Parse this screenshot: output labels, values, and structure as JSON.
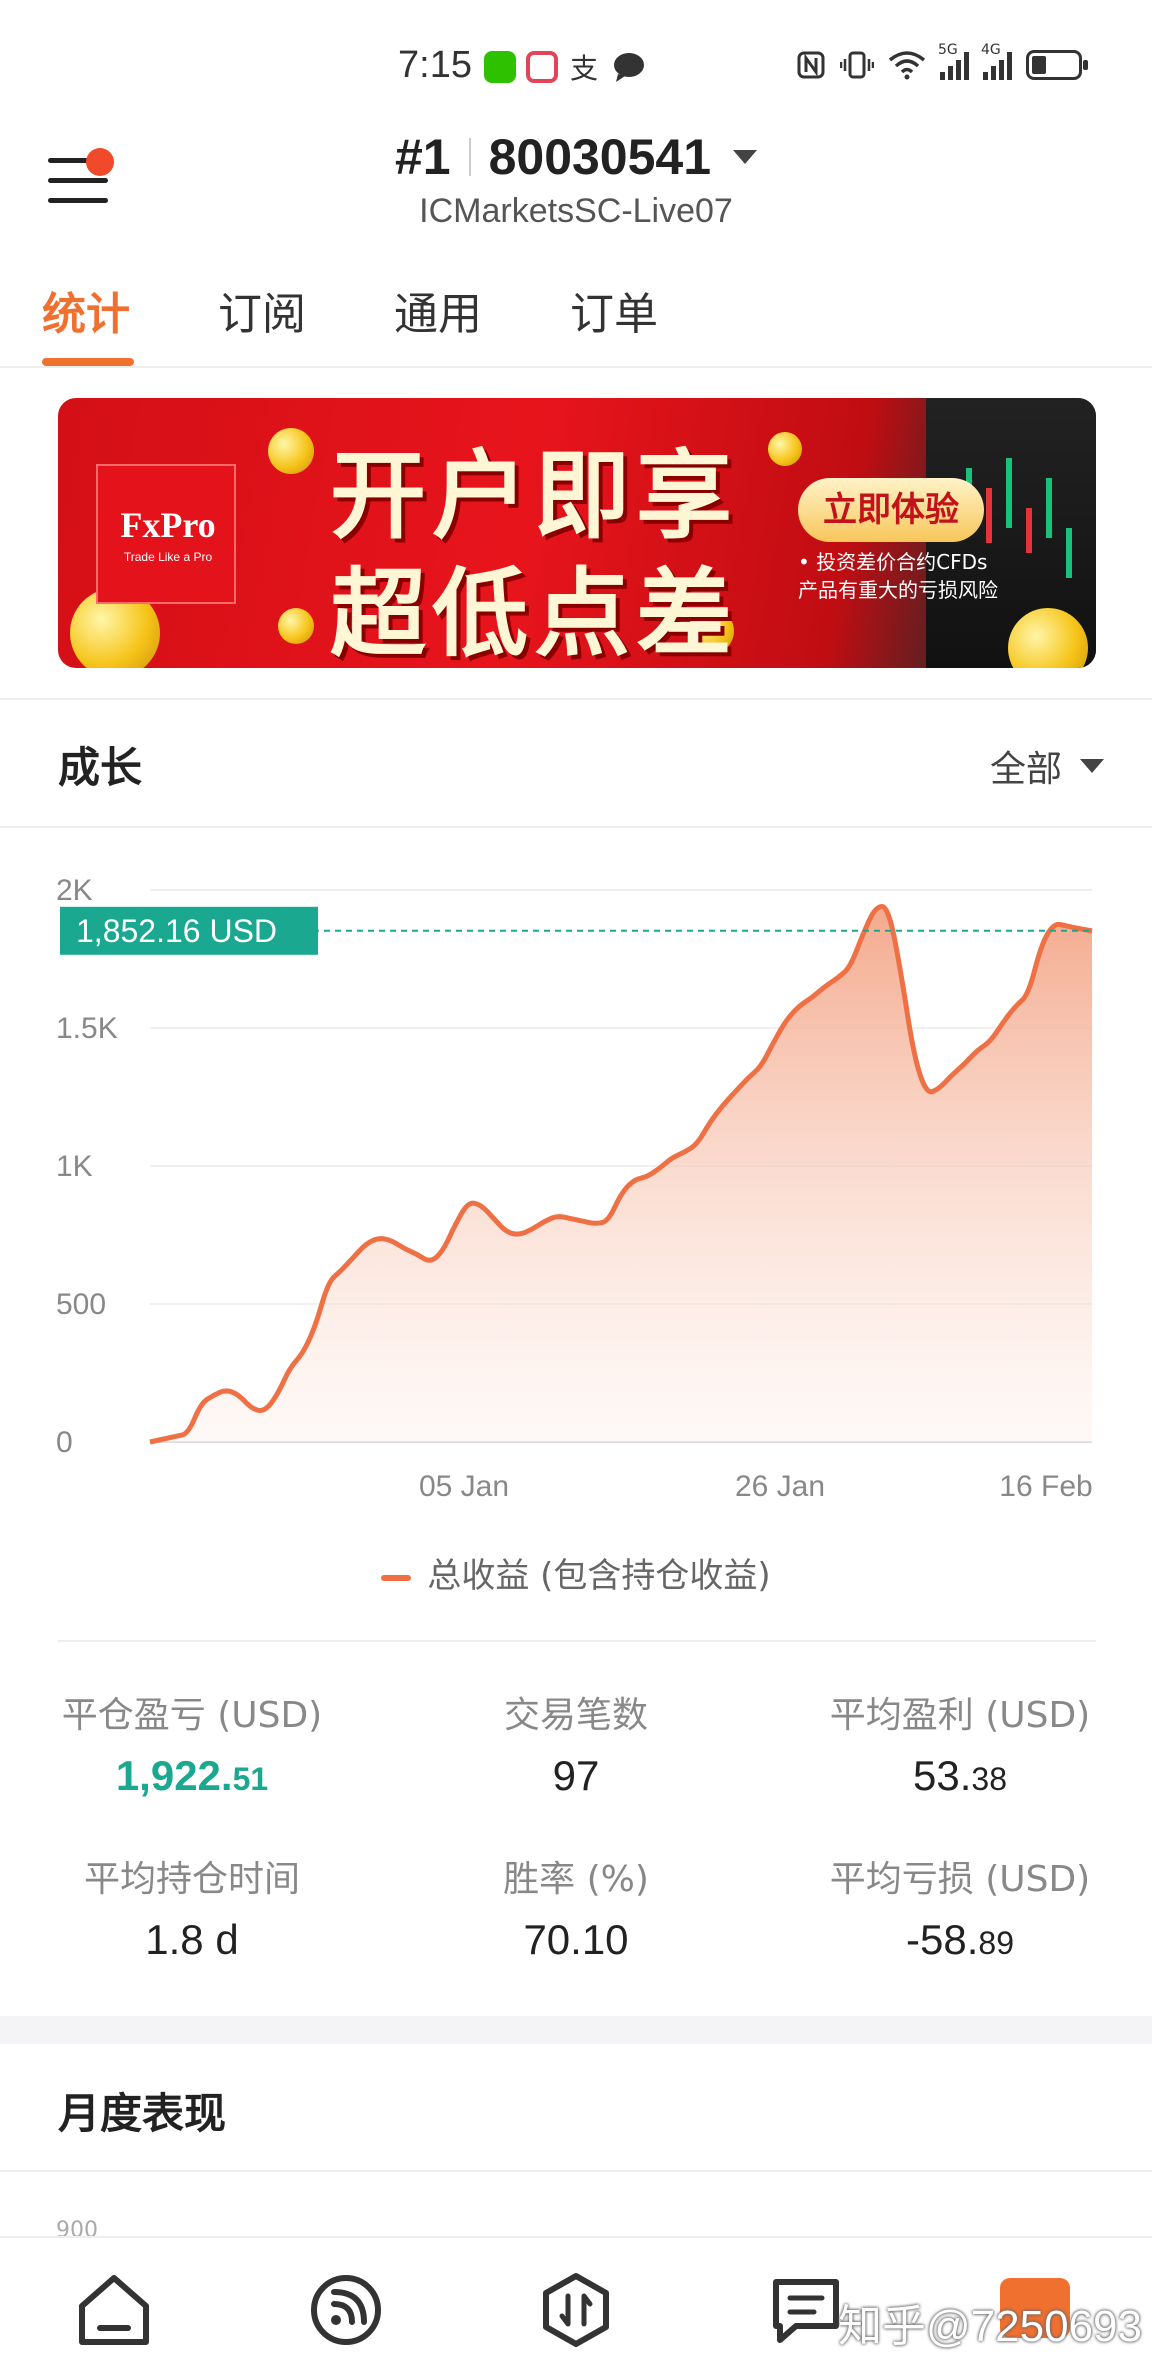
{
  "status_bar": {
    "time": "7:15",
    "signal_1": "5G",
    "signal_2": "4G"
  },
  "header": {
    "rank": "#1",
    "account": "80030541",
    "server": "ICMarketsSC-Live07"
  },
  "tabs": [
    {
      "label": "统计",
      "active": true
    },
    {
      "label": "订阅",
      "active": false
    },
    {
      "label": "通用",
      "active": false
    },
    {
      "label": "订单",
      "active": false
    }
  ],
  "banner": {
    "logo": "FxPro",
    "tagline": "Trade Like a Pro",
    "line1": "开户即享",
    "line2": "超低点差",
    "cta": "立即体验",
    "risk_1": "• 投资差价合约CFDs",
    "risk_2": "产品有重大的亏损风险"
  },
  "growth": {
    "title": "成长",
    "filter": "全部",
    "current_label": "1,852.16 USD",
    "legend": "总收益 (包含持仓收益)"
  },
  "chart_data": {
    "type": "area",
    "y_ticks": [
      "2K",
      "1.5K",
      "1K",
      "500",
      "0"
    ],
    "x_ticks": [
      "05 Jan",
      "26 Jan",
      "16 Feb"
    ],
    "ylim": [
      0,
      2000
    ],
    "current_value": 1852.16,
    "series": [
      {
        "name": "总收益 (包含持仓收益)",
        "values": [
          0,
          10,
          20,
          30,
          140,
          170,
          190,
          170,
          120,
          110,
          170,
          270,
          320,
          420,
          580,
          620,
          670,
          720,
          740,
          730,
          700,
          680,
          650,
          690,
          790,
          870,
          860,
          810,
          760,
          750,
          770,
          800,
          820,
          810,
          800,
          790,
          800,
          900,
          950,
          960,
          990,
          1030,
          1050,
          1080,
          1160,
          1220,
          1270,
          1320,
          1360,
          1450,
          1530,
          1580,
          1610,
          1650,
          1680,
          1720,
          1840,
          1940,
          1940,
          1700,
          1400,
          1260,
          1280,
          1330,
          1370,
          1420,
          1450,
          1520,
          1580,
          1620,
          1800,
          1880,
          1870,
          1860,
          1852
        ]
      }
    ],
    "color": "#ee7044"
  },
  "stats": [
    {
      "label": "平仓盈亏 (USD)",
      "int": "1,922.",
      "dec": "51",
      "green": true
    },
    {
      "label": "交易笔数",
      "int": "97",
      "dec": "",
      "green": false
    },
    {
      "label": "平均盈利 (USD)",
      "int": "53.",
      "dec": "38",
      "green": false
    },
    {
      "label": "平均持仓时间",
      "int": "1.8 d",
      "dec": "",
      "green": false
    },
    {
      "label": "胜率 (%)",
      "int": "70.10",
      "dec": "",
      "green": false
    },
    {
      "label": "平均亏损 (USD)",
      "int": "-58.",
      "dec": "89",
      "green": false
    }
  ],
  "monthly": {
    "title": "月度表现",
    "axis_peek": "900"
  },
  "bottom_nav": [
    "home-icon",
    "feed-icon",
    "trade-icon",
    "messages-icon",
    "profile-icon"
  ],
  "watermark": "知乎@7250693"
}
